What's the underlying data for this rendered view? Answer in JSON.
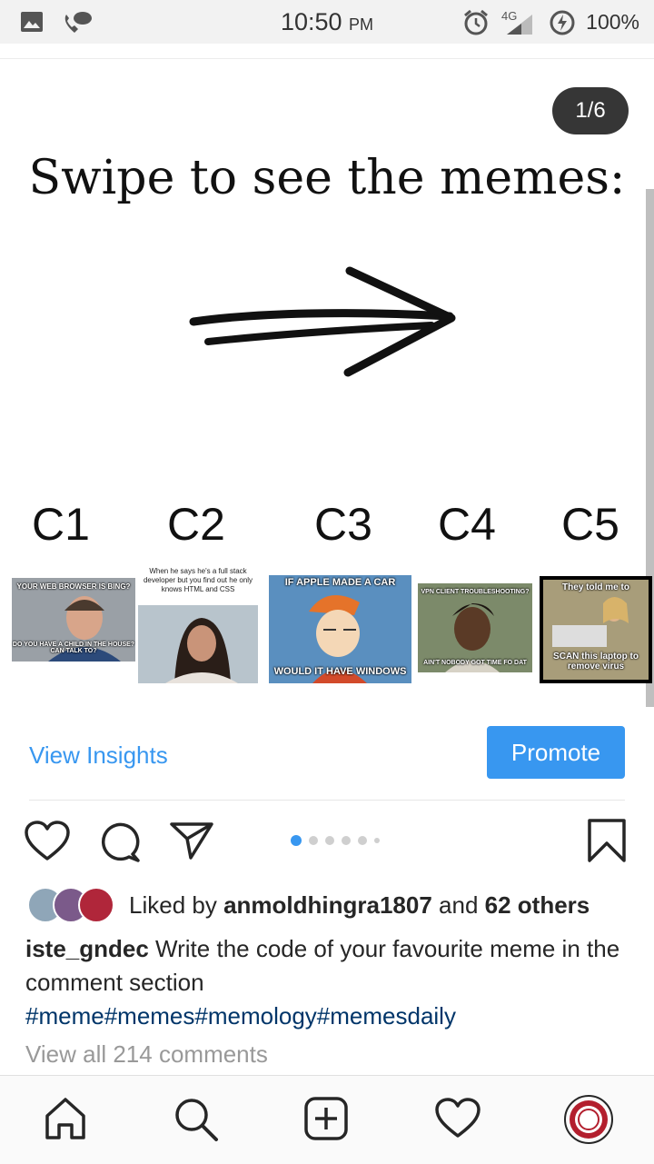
{
  "status_bar": {
    "time": "10:50",
    "ampm": "PM",
    "network": "4G",
    "battery": "100%"
  },
  "post": {
    "slide_counter": "1/6",
    "headline": "Swipe to see the memes:",
    "candidates": [
      "C1",
      "C2",
      "C3",
      "C4",
      "C5"
    ],
    "memes": [
      {
        "top": "YOUR WEB BROWSER IS BING?",
        "bottom": "DO YOU HAVE A CHILD IN THE HOUSE? CAN TALK TO?"
      },
      {
        "top": "When he says he's a full stack developer but you find out he only knows HTML and CSS",
        "bottom": ""
      },
      {
        "top": "IF APPLE MADE A CAR",
        "bottom": "WOULD IT HAVE WINDOWS"
      },
      {
        "top": "VPN CLIENT TROUBLESHOOTING?",
        "bottom": "AIN'T NOBODY GOT TIME FO DAT"
      },
      {
        "top": "They told me to",
        "bottom": "SCAN this laptop to remove virus"
      }
    ]
  },
  "actions": {
    "insights_label": "View Insights",
    "promote_label": "Promote"
  },
  "likes": {
    "prefix": "Liked by ",
    "user": "anmoldhingra1807",
    "middle": " and ",
    "others": "62 others"
  },
  "caption": {
    "username": "iste_gndec",
    "text": " Write the code of your favourite meme in the comment section",
    "hashtags": "#meme#memes#memology#memesdaily"
  },
  "comments": {
    "view_all": "View all 214 comments"
  },
  "colors": {
    "accent": "#3897f0",
    "hashtag": "#003569",
    "text": "#262626",
    "muted": "#999999"
  }
}
